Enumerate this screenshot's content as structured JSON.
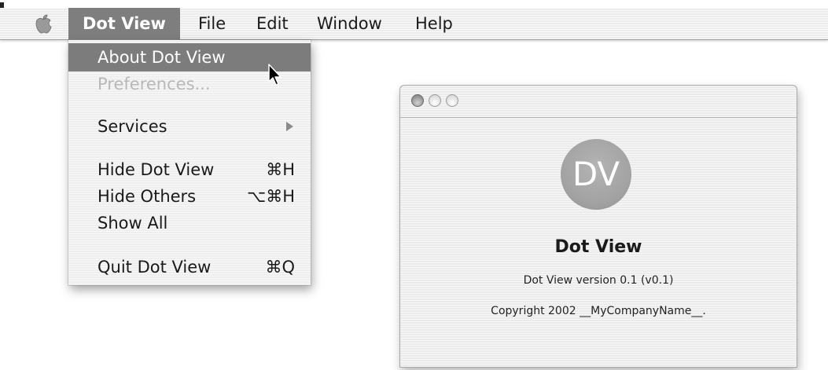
{
  "menubar": {
    "apple_icon": "apple-logo",
    "menus": [
      {
        "label": "Dot View",
        "active": true
      },
      {
        "label": "File"
      },
      {
        "label": "Edit"
      },
      {
        "label": "Window"
      },
      {
        "label": "Help"
      }
    ]
  },
  "app_menu": {
    "items": [
      {
        "label": "About Dot View",
        "shortcut": "",
        "highlighted": true
      },
      {
        "label": "Preferences...",
        "shortcut": "",
        "disabled": true
      },
      {
        "label": "Services",
        "submenu": true
      },
      {
        "label": "Hide Dot View",
        "shortcut": "⌘H"
      },
      {
        "label": "Hide Others",
        "shortcut": "⌥⌘H"
      },
      {
        "label": "Show All",
        "shortcut": ""
      },
      {
        "label": "Quit Dot View",
        "shortcut": "⌘Q"
      }
    ]
  },
  "about_window": {
    "logo_text": "DV",
    "app_name": "Dot View",
    "version": "Dot View version 0.1 (v0.1)",
    "copyright": "Copyright 2002 __MyCompanyName__."
  },
  "colors": {
    "highlight": "#7c7c7c",
    "logo": "#a2a2a2",
    "disabled_text": "#b8b8b8"
  }
}
